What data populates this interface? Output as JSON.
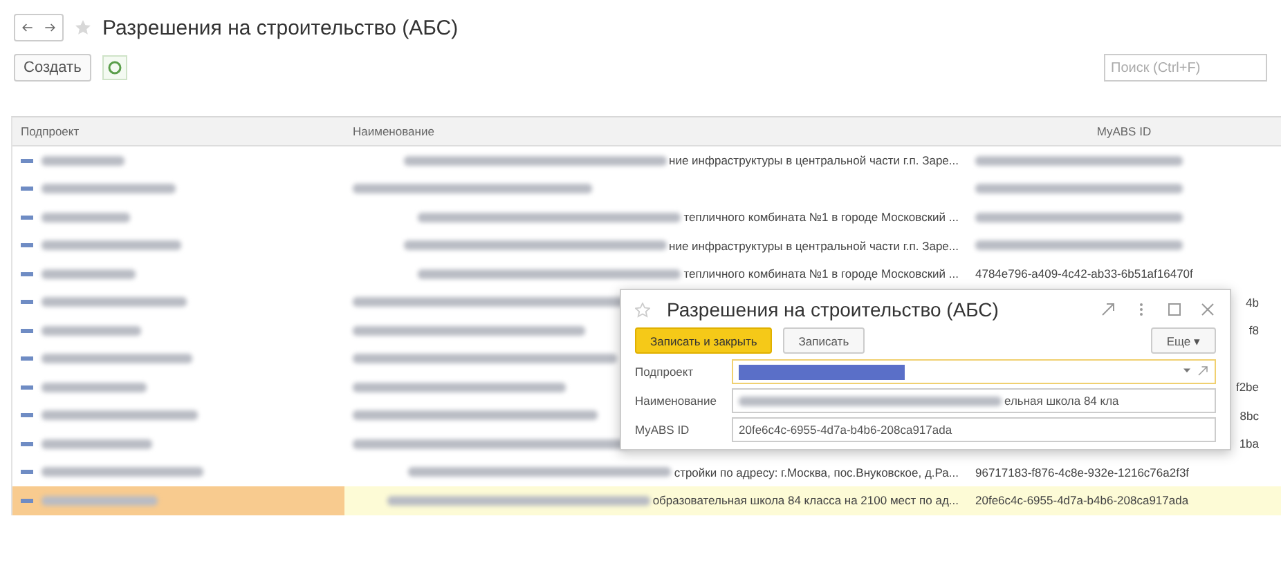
{
  "window": {
    "title": "Разрешения на строительство (АБС)"
  },
  "toolbar": {
    "create_button": "Создать",
    "search": {
      "placeholder": "Поиск (Ctrl+F)"
    }
  },
  "table": {
    "columns": [
      "Подпроект",
      "Наименование",
      "MyABS ID"
    ],
    "rows": [
      {
        "selected": false,
        "name_tail": "ние инфраструктуры в центральной части г.п. Заре...",
        "id_blurred": true
      },
      {
        "selected": false,
        "id_blurred": true
      },
      {
        "selected": false,
        "name_tail": "тепличного комбината №1 в городе Московский ...",
        "id_blurred": true
      },
      {
        "selected": false,
        "name_tail": "ние инфраструктуры в центральной части г.п. Заре...",
        "id_blurred": true
      },
      {
        "selected": false,
        "name_tail": "тепличного комбината №1 в городе Московский ...",
        "id": "4784e796-a409-4c42-ab33-6b51af16470f"
      },
      {
        "selected": false,
        "id_tail": "4b"
      },
      {
        "selected": false,
        "id_tail": "f8"
      },
      {
        "selected": false
      },
      {
        "selected": false,
        "id_tail": "f2be"
      },
      {
        "selected": false,
        "id_tail": "8bc"
      },
      {
        "selected": false,
        "id_tail": "1ba"
      },
      {
        "selected": false,
        "name_tail": "стройки по адресу: г.Москва, пос.Внуковское, д.Ра...",
        "id": "96717183-f876-4c8e-932e-1216c76a2f3f"
      },
      {
        "selected": true,
        "name_tail": "образовательная школа 84 класса на 2100 мест по ад...",
        "id": "20fe6c4c-6955-4d7a-b4b6-208ca917ada"
      }
    ]
  },
  "dialog": {
    "title": "Разрешения на строительство (АБС)",
    "save_close_button": "Записать и закрыть",
    "save_button": "Записать",
    "more_button": "Еще ▾",
    "fields": [
      {
        "kind": "select",
        "label": "Подпроект"
      },
      {
        "kind": "text",
        "label": "Наименование",
        "value_tail": "ельная школа 84 кла"
      },
      {
        "kind": "text",
        "label": "MyABS ID",
        "value": "20fe6c4c-6955-4d7a-b4b6-208ca917ada"
      }
    ]
  }
}
